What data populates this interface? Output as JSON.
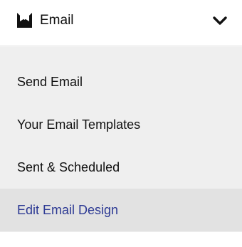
{
  "header": {
    "label": "Email",
    "icon": "email-inbox-icon",
    "chevron_icon": "chevron-down-icon"
  },
  "submenu": {
    "items": [
      {
        "label": "Send Email",
        "active": false
      },
      {
        "label": "Your Email Templates",
        "active": false
      },
      {
        "label": "Sent & Scheduled",
        "active": false
      },
      {
        "label": "Edit Email Design",
        "active": true
      }
    ]
  },
  "colors": {
    "active_text": "#2d3a94",
    "active_bg": "#e2e2e2",
    "submenu_bg": "#efefef",
    "text": "#111111"
  }
}
